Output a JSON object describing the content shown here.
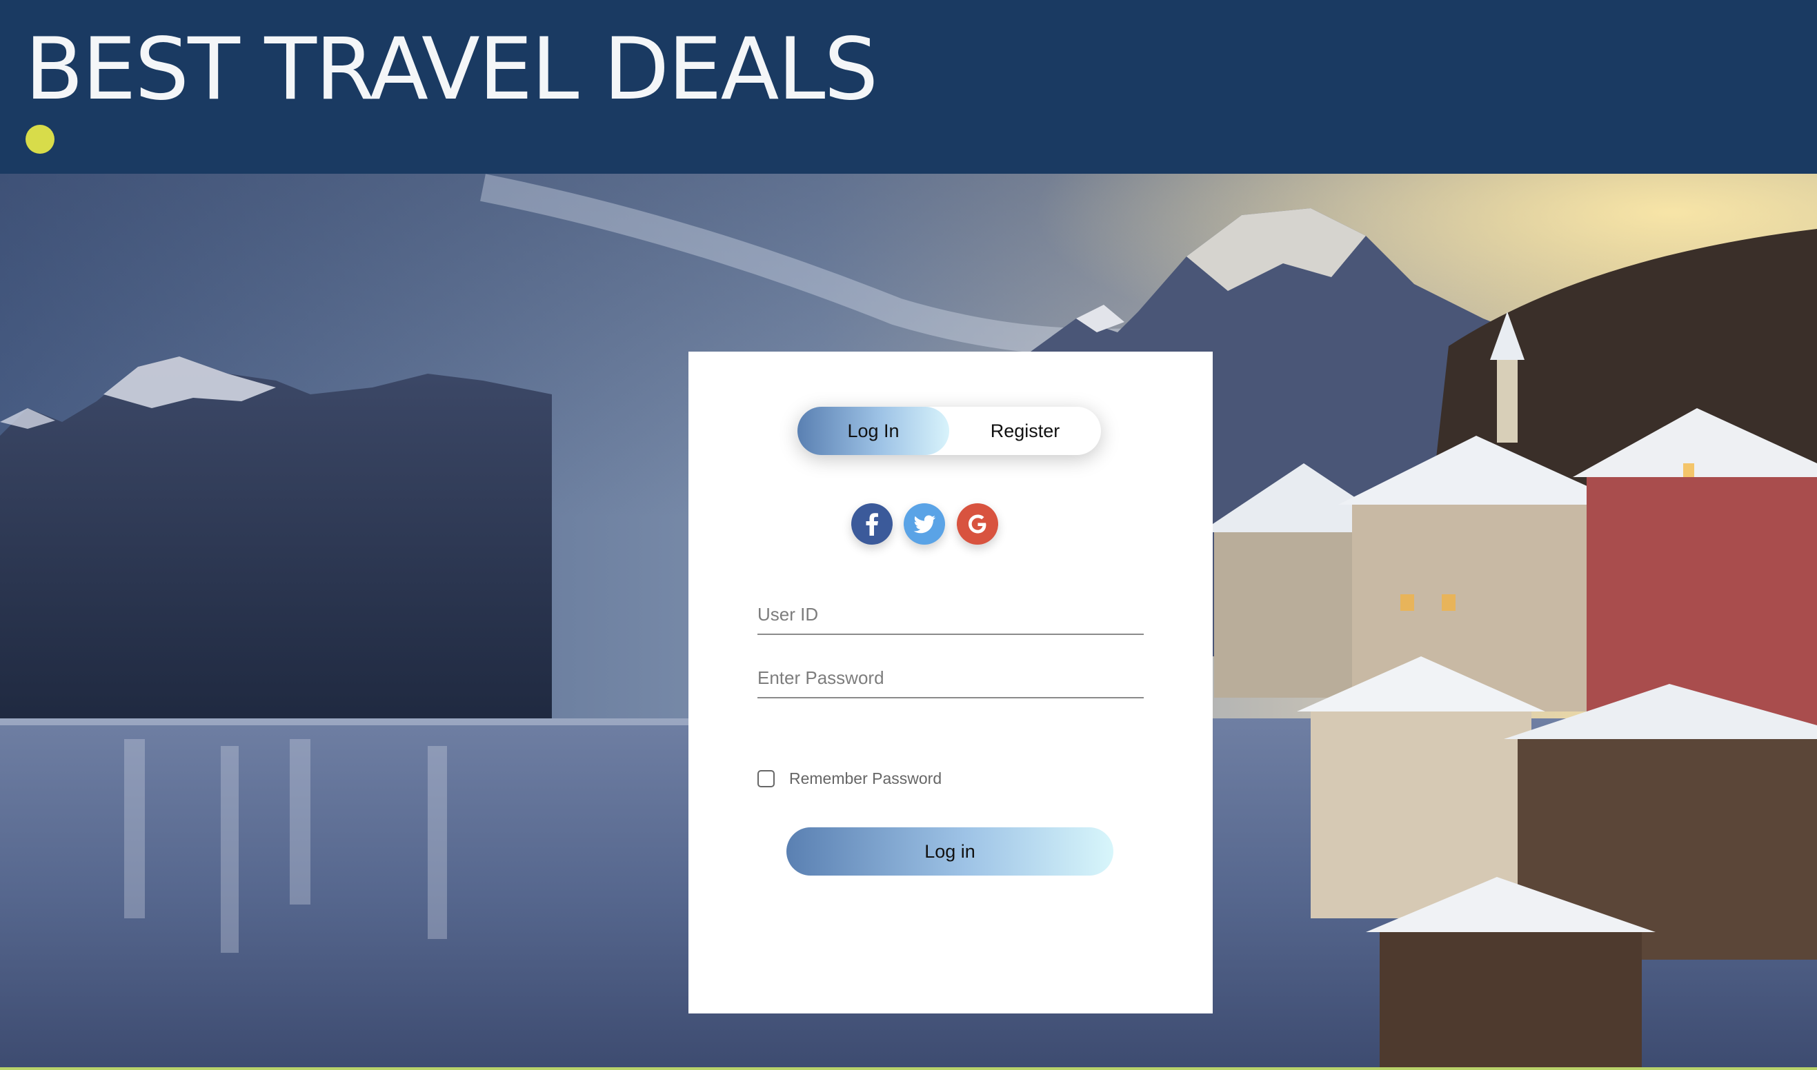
{
  "header": {
    "title": "BEST TRAVEL DEALS"
  },
  "auth": {
    "tabs": [
      {
        "label": "Log In",
        "active": true
      },
      {
        "label": "Register",
        "active": false
      }
    ],
    "social": [
      {
        "name": "facebook",
        "icon": "facebook-icon",
        "color": "#3b5a9a"
      },
      {
        "name": "twitter",
        "icon": "twitter-icon",
        "color": "#5aa3e6"
      },
      {
        "name": "google",
        "icon": "google-icon",
        "color": "#d8533f"
      }
    ],
    "user_id": {
      "placeholder": "User ID",
      "value": ""
    },
    "password": {
      "placeholder": "Enter Password",
      "value": ""
    },
    "remember_label": "Remember Password",
    "remember_checked": false,
    "submit_label": "Log in"
  },
  "colors": {
    "header_bg": "#1a3a62",
    "accent_dot": "#d8dc4a",
    "button_gradient_start": "#5a80b2",
    "button_gradient_end": "#d8f3fb"
  }
}
